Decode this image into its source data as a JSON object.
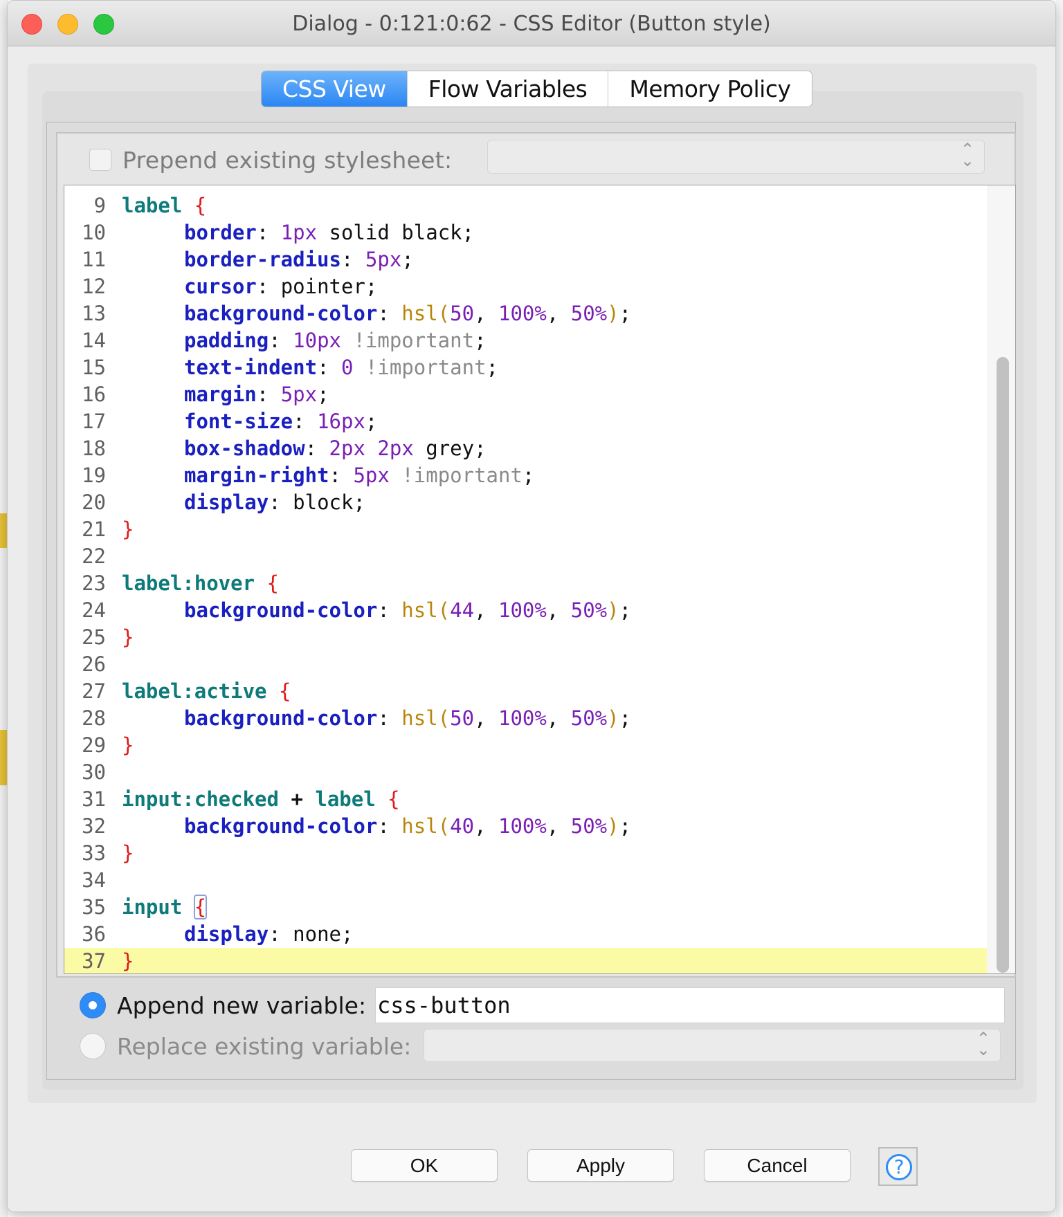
{
  "window": {
    "title": "Dialog - 0:121:0:62 - CSS Editor (Button style)"
  },
  "tabs": [
    {
      "label": "CSS View",
      "active": true
    },
    {
      "label": "Flow Variables",
      "active": false
    },
    {
      "label": "Memory Policy",
      "active": false
    }
  ],
  "prepend": {
    "label": "Prepend existing stylesheet:",
    "checked": false,
    "selected": ""
  },
  "editor": {
    "current_line": 37,
    "lines": [
      {
        "n": "9",
        "code": "label {"
      },
      {
        "n": "10",
        "code": "border: 1px solid black;"
      },
      {
        "n": "11",
        "code": "border-radius: 5px;"
      },
      {
        "n": "12",
        "code": "cursor: pointer;"
      },
      {
        "n": "13",
        "code": "background-color: hsl(50, 100%, 50%);"
      },
      {
        "n": "14",
        "code": "padding: 10px !important;"
      },
      {
        "n": "15",
        "code": "text-indent: 0 !important;"
      },
      {
        "n": "16",
        "code": "margin: 5px;"
      },
      {
        "n": "17",
        "code": "font-size: 16px;"
      },
      {
        "n": "18",
        "code": "box-shadow: 2px 2px grey;"
      },
      {
        "n": "19",
        "code": "margin-right: 5px !important;"
      },
      {
        "n": "20",
        "code": "display: block;"
      },
      {
        "n": "21",
        "code": "}"
      },
      {
        "n": "22",
        "code": ""
      },
      {
        "n": "23",
        "code": "label:hover {"
      },
      {
        "n": "24",
        "code": "background-color: hsl(44, 100%, 50%);"
      },
      {
        "n": "25",
        "code": "}"
      },
      {
        "n": "26",
        "code": ""
      },
      {
        "n": "27",
        "code": "label:active {"
      },
      {
        "n": "28",
        "code": "background-color: hsl(50, 100%, 50%);"
      },
      {
        "n": "29",
        "code": "}"
      },
      {
        "n": "30",
        "code": ""
      },
      {
        "n": "31",
        "code": "input:checked + label {"
      },
      {
        "n": "32",
        "code": "background-color: hsl(40, 100%, 50%);"
      },
      {
        "n": "33",
        "code": "}"
      },
      {
        "n": "34",
        "code": ""
      },
      {
        "n": "35",
        "code": "input {"
      },
      {
        "n": "36",
        "code": "display: none;"
      },
      {
        "n": "37",
        "code": "}"
      }
    ]
  },
  "variable": {
    "append_label": "Append new variable:",
    "append_value": "css-button",
    "append_selected": true,
    "replace_label": "Replace existing variable:",
    "replace_selected": false,
    "replace_value": ""
  },
  "buttons": {
    "ok": "OK",
    "apply": "Apply",
    "cancel": "Cancel",
    "help": "?"
  },
  "colors": {
    "accent": "#2f8bf5",
    "selector": "#0e7a7a",
    "property": "#1a1fbf",
    "number": "#7a1fb4",
    "function": "#b8860b",
    "brace": "#e01818",
    "current_line": "#fbfba6"
  }
}
